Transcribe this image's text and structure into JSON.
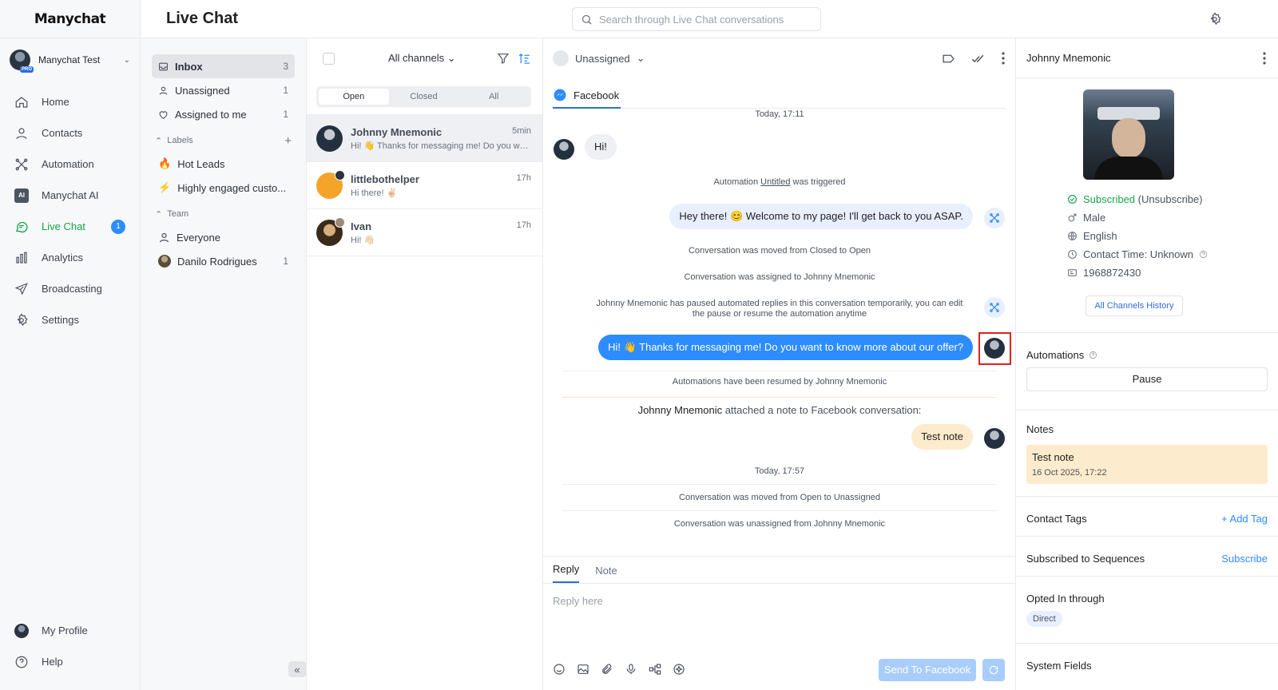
{
  "brand": "Manychat",
  "account": {
    "name": "Manychat Test",
    "badge": "PRO"
  },
  "nav": {
    "items": [
      {
        "label": "Home",
        "icon": "home-icon"
      },
      {
        "label": "Contacts",
        "icon": "contacts-icon"
      },
      {
        "label": "Automation",
        "icon": "automation-icon"
      },
      {
        "label": "Manychat AI",
        "icon": "ai-icon",
        "icon_text": "AI"
      },
      {
        "label": "Live Chat",
        "icon": "chat-icon",
        "badge": "1"
      },
      {
        "label": "Analytics",
        "icon": "analytics-icon"
      },
      {
        "label": "Broadcasting",
        "icon": "broadcast-icon"
      },
      {
        "label": "Settings",
        "icon": "settings-icon"
      }
    ],
    "bottom": [
      {
        "label": "My Profile"
      },
      {
        "label": "Help"
      }
    ]
  },
  "header": {
    "title": "Live Chat",
    "search_placeholder": "Search through Live Chat conversations"
  },
  "folders": {
    "inbox": {
      "label": "Inbox",
      "count": "3"
    },
    "unassigned": {
      "label": "Unassigned",
      "count": "1"
    },
    "assigned": {
      "label": "Assigned to me",
      "count": "1"
    },
    "labels_title": "Labels",
    "labels": [
      {
        "emoji": "🔥",
        "label": "Hot Leads"
      },
      {
        "emoji": "⚡",
        "label": "Highly engaged custo..."
      }
    ],
    "team_title": "Team",
    "team": [
      {
        "label": "Everyone",
        "count": ""
      },
      {
        "label": "Danilo Rodrigues",
        "count": "1"
      }
    ],
    "collapse": "«"
  },
  "convlist": {
    "channels": "All channels",
    "segments": [
      "Open",
      "Closed",
      "All"
    ],
    "items": [
      {
        "name": "Johnny Mnemonic",
        "time": "5min",
        "preview": "Hi! 👋 Thanks for messaging me! Do you want to know more about our offer?"
      },
      {
        "name": "littlebothelper",
        "time": "17h",
        "preview": "Hi there! ✌🏻"
      },
      {
        "name": "Ivan",
        "time": "17h",
        "preview": "Hi! 👋🏻"
      }
    ]
  },
  "chat": {
    "assignee": "Unassigned",
    "channel_tab": "Facebook",
    "date1": "Today, 17:11",
    "msg_in": "Hi!",
    "sys_automation_prefix": "Automation ",
    "sys_automation_name": "Untitled",
    "sys_automation_suffix": " was triggered",
    "msg_auto": "Hey there! 😊 Welcome to my page! I'll get back to you ASAP.",
    "sys_moved": "Conversation was moved from Closed to Open",
    "sys_assigned": "Conversation was assigned to Johnny Mnemonic",
    "sys_paused_1": "Johnny Mnemonic has paused automated replies in this conversation temporarily, you can edit",
    "sys_paused_2": "the pause or resume the automation anytime",
    "msg_out": "Hi! 👋 Thanks for messaging me! Do you want to know more about our offer?",
    "sys_resumed": "Automations have been resumed by Johnny Mnemonic",
    "note_author": "Johnny Mnemonic",
    "note_action": " attached a note to Facebook conversation:",
    "note_text": "Test note",
    "date2": "Today, 17:57",
    "sys_moved2": "Conversation was moved from Open to Unassigned",
    "sys_unassigned": "Conversation was unassigned from Johnny Mnemonic",
    "composer_tabs": [
      "Reply",
      "Note"
    ],
    "composer_placeholder": "Reply here",
    "send_label": "Send To Facebook"
  },
  "profile": {
    "name": "Johnny Mnemonic",
    "subscribed": "Subscribed",
    "unsubscribe": "(Unsubscribe)",
    "gender": "Male",
    "language": "English",
    "contact_time": "Contact Time: Unknown",
    "id": "1968872430",
    "history_button": "All Channels History",
    "automations_title": "Automations",
    "pause_button": "Pause",
    "notes_title": "Notes",
    "note": {
      "text": "Test note",
      "date": "16 Oct 2025, 17:22"
    },
    "tags_title": "Contact Tags",
    "add_tag": "+ Add Tag",
    "sequences_title": "Subscribed to Sequences",
    "subscribe": "Subscribe",
    "opted_title": "Opted In through",
    "opted_chip": "Direct",
    "system_fields_title": "System Fields"
  },
  "colors": {
    "accent_blue": "#2d8cff",
    "active_green": "#16a34a",
    "note_bg": "#fdebcd",
    "highlight_red": "#e02020"
  }
}
